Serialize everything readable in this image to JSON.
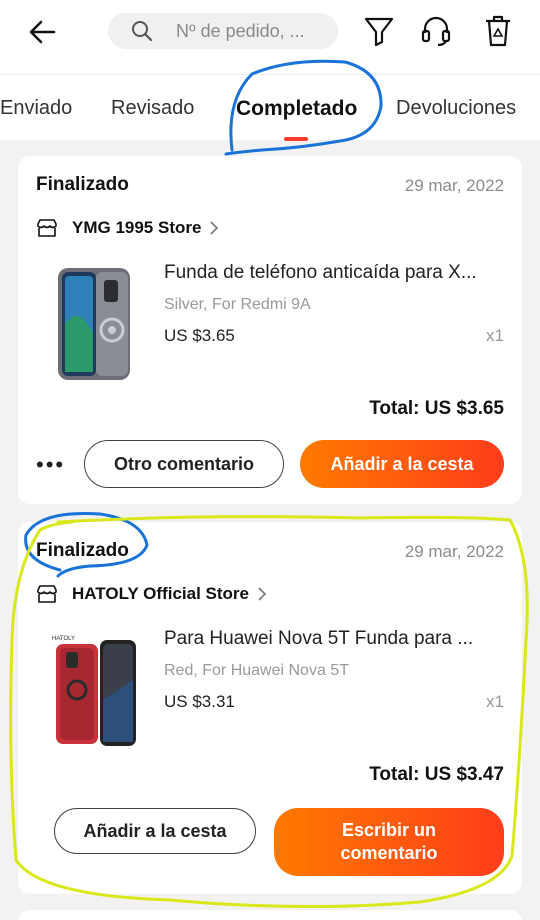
{
  "search": {
    "placeholder": "Nº de pedido, ..."
  },
  "header": {
    "icons": [
      "back-arrow-icon",
      "search-icon",
      "filter-icon",
      "headset-icon",
      "trash-icon"
    ]
  },
  "tabs": [
    {
      "label": "Enviado"
    },
    {
      "label": "Revisado"
    },
    {
      "label": "Completado",
      "active": true
    },
    {
      "label": "Devoluciones"
    }
  ],
  "orders": [
    {
      "status": "Finalizado",
      "date": "29 mar, 2022",
      "store": "YMG 1995 Store",
      "product": {
        "title": "Funda de teléfono anticaída para X...",
        "variant": "Silver, For Redmi 9A",
        "price": "US $3.65",
        "qty": "x1"
      },
      "total": "Total: US $3.65",
      "more": "•••",
      "buttons": {
        "secondary": "Otro comentario",
        "primary": "Añadir a la cesta"
      }
    },
    {
      "status": "Finalizado",
      "date": "29 mar, 2022",
      "store": "HATOLY Official Store",
      "product": {
        "title": "Para Huawei Nova 5T Funda para ...",
        "variant": "Red, For Huawei Nova 5T",
        "price": "US $3.31",
        "qty": "x1",
        "brand_mark": "HATOLY"
      },
      "total": "Total: US $3.47",
      "buttons": {
        "secondary": "Añadir a la cesta",
        "primary": "Escribir un comentario"
      }
    }
  ],
  "colors": {
    "accent": "#ff3d1a",
    "accent_start": "#ff7a00",
    "annotation_blue": "#1a73d9",
    "annotation_yellow": "#d9e81a"
  }
}
